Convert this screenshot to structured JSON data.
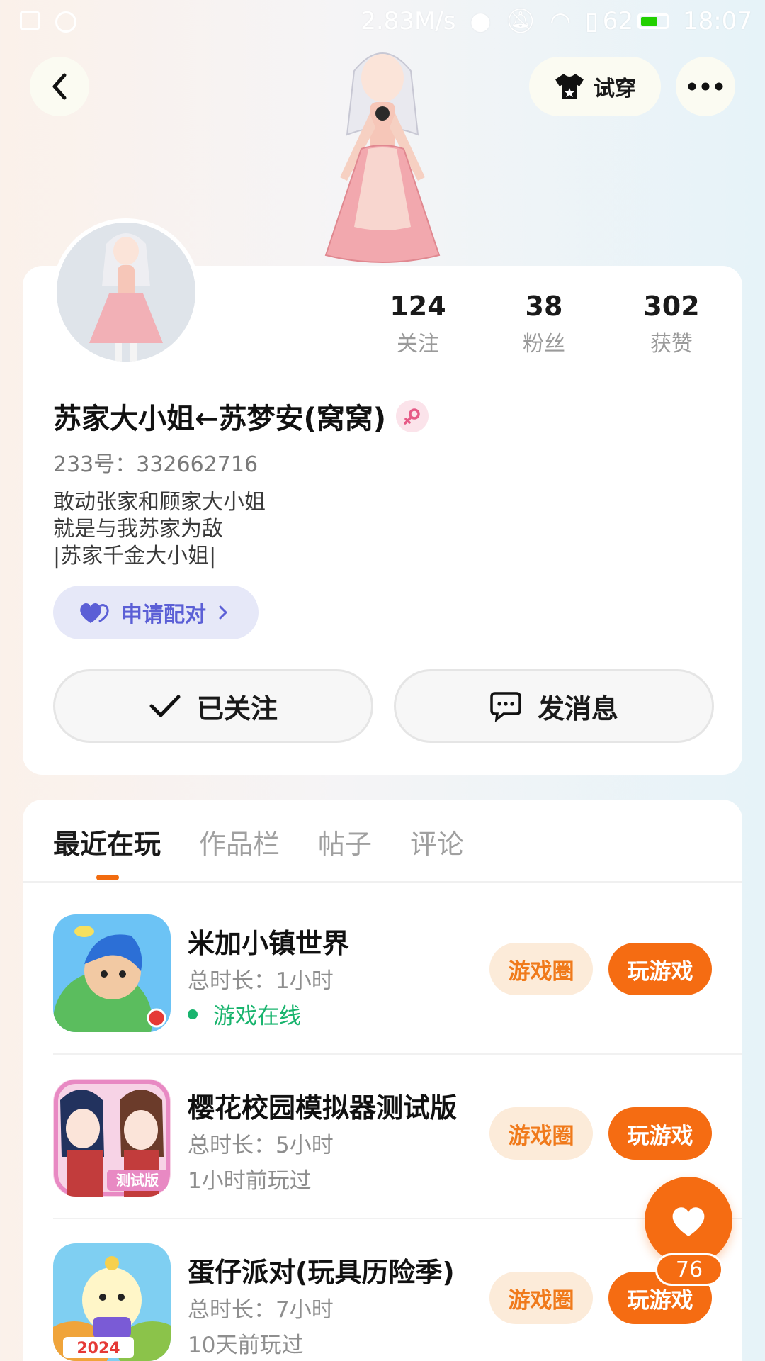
{
  "status_bar": {
    "speed": "2.83M/s",
    "battery": "62",
    "time": "18:07"
  },
  "header": {
    "tryon_label": "试穿"
  },
  "profile": {
    "stats": [
      {
        "value": "124",
        "label": "关注"
      },
      {
        "value": "38",
        "label": "粉丝"
      },
      {
        "value": "302",
        "label": "获赞"
      }
    ],
    "username": "苏家大小姐←苏梦安(窝窝)",
    "account_id": "233号：332662716",
    "bio_lines": [
      "敢动张家和顾家大小姐",
      "就是与我苏家为敌",
      "|苏家千金大小姐|"
    ],
    "pair_label": "申请配对",
    "follow_label": "已关注",
    "message_label": "发消息"
  },
  "tabs": [
    "最近在玩",
    "作品栏",
    "帖子",
    "评论"
  ],
  "games": [
    {
      "name": "米加小镇世界",
      "duration": "总时长：1小时",
      "status": "游戏在线",
      "online": true,
      "circle_label": "游戏圈",
      "play_label": "玩游戏"
    },
    {
      "name": "樱花校园模拟器测试版",
      "duration": "总时长：5小时",
      "status": "1小时前玩过",
      "online": false,
      "circle_label": "游戏圈",
      "play_label": "玩游戏",
      "icon_badge": "测试版"
    },
    {
      "name": "蛋仔派对(玩具历险季)",
      "duration": "总时长：7小时",
      "status": "10天前玩过",
      "online": false,
      "circle_label": "游戏圈",
      "play_label": "玩游戏",
      "icon_badge": "2024"
    }
  ],
  "like": {
    "count": "76"
  },
  "colors": {
    "accent": "#f56c12",
    "online": "#19b46e",
    "pair": "#5b5fd6"
  }
}
